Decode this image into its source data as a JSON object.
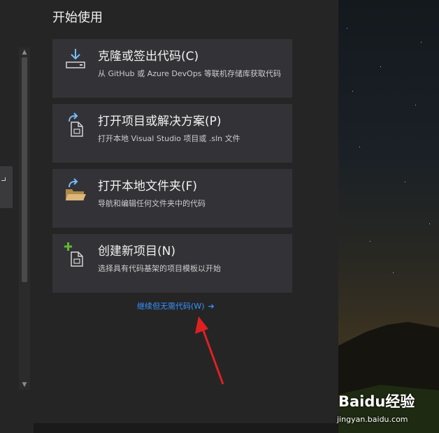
{
  "start": {
    "title": "开始使用",
    "cards": [
      {
        "title": "克隆或签出代码(C)",
        "description": "从 GitHub 或 Azure DevOps 等联机存储库获取代码",
        "icon": "clone-download-icon"
      },
      {
        "title": "打开项目或解决方案(P)",
        "description": "打开本地 Visual Studio 项目或 .sln 文件",
        "icon": "open-project-icon"
      },
      {
        "title": "打开本地文件夹(F)",
        "description": "导航和编辑任何文件夹中的代码",
        "icon": "open-folder-icon"
      },
      {
        "title": "创建新项目(N)",
        "description": "选择具有代码基架的项目模板以开始",
        "icon": "new-project-icon"
      }
    ],
    "continue_link": "继续但无需代码(W)",
    "continue_arrow": "➔"
  },
  "scrollbar": {
    "up_arrow": "▲",
    "down_arrow": "▼"
  },
  "watermark": {
    "logo": "Baidu经验",
    "url": "jingyan.baidu.com"
  },
  "colors": {
    "background": "#252526",
    "card": "#333337",
    "link": "#3794ff",
    "icon_blue": "#75beff",
    "icon_green": "#5fb832",
    "annotation_red": "#e02020"
  }
}
